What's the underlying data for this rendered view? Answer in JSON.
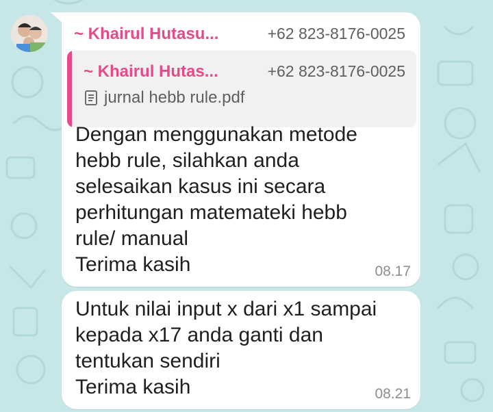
{
  "message1": {
    "sender_name": "~ Khairul Hutasu...",
    "sender_phone": "+62 823-8176-0025",
    "quoted": {
      "name": "~ Khairul Hutas...",
      "phone": "+62 823-8176-0025",
      "file_name": "jurnal hebb rule.pdf",
      "file_icon": "document-icon"
    },
    "lines": [
      "Dengan menggunakan metode",
      "hebb rule, silahkan anda",
      "selesaikan kasus ini secara",
      "perhitungan matemateki hebb",
      "rule/ manual",
      "Terima kasih"
    ],
    "time": "08.17"
  },
  "message2": {
    "lines": [
      "Untuk nilai input x dari x1 sampai",
      "kepada x17 anda ganti dan",
      "tentukan sendiri",
      "Terima kasih"
    ],
    "time": "08.21"
  },
  "colors": {
    "wallpaper": "#c6e6e8",
    "bubble": "#ffffff",
    "sender": "#e74a8a",
    "quote_bg": "#f1f1f1"
  }
}
